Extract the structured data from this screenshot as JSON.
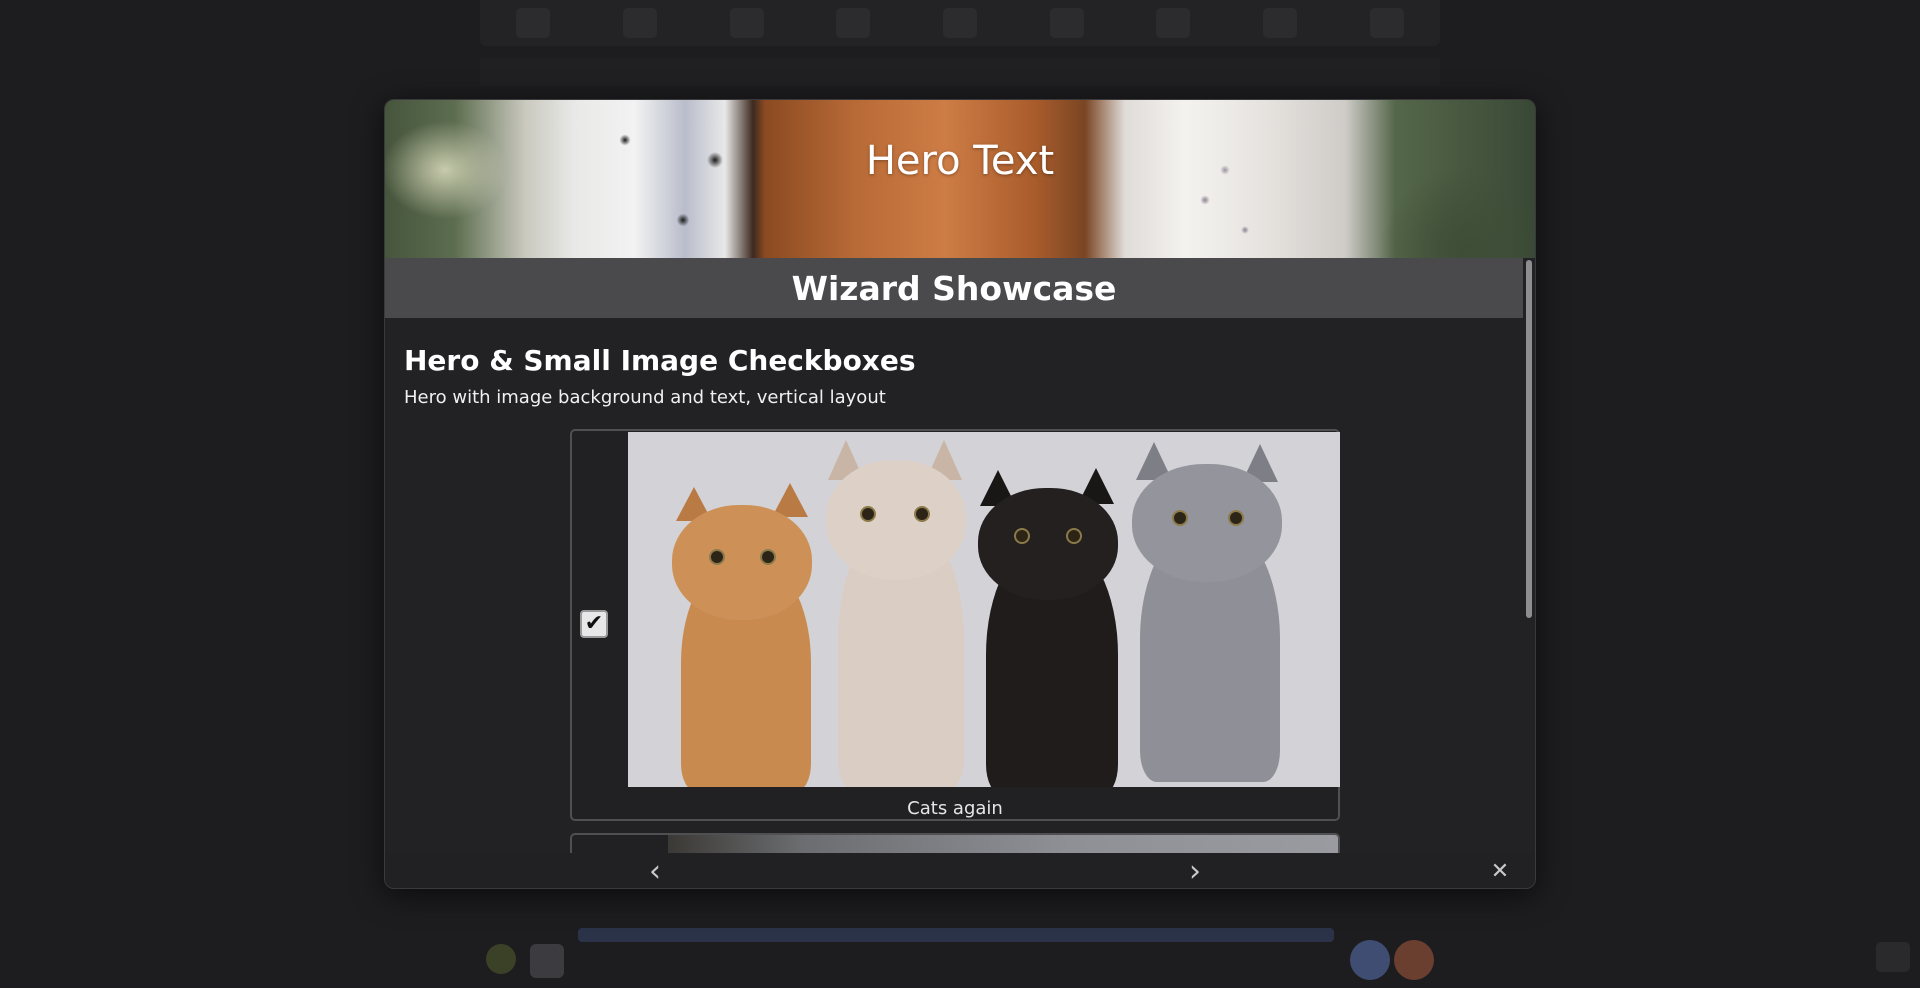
{
  "modal": {
    "hero": {
      "text": "Hero Text"
    },
    "title": "Wizard Showcase",
    "section": {
      "heading": "Hero & Small Image Checkboxes",
      "description": "Hero with image background and text, vertical layout"
    },
    "options": [
      {
        "caption": "Cats again",
        "checked": true,
        "image_icon": "cats-image"
      }
    ],
    "nav": {
      "prev_icon": "chevron-left-icon",
      "next_icon": "chevron-right-icon",
      "close_icon": "close-icon",
      "prev_glyph": "‹",
      "next_glyph": "›",
      "close_glyph": "✕"
    }
  },
  "checkbox_glyph": "✔",
  "colors": {
    "page_bg": "#1d1c1e",
    "modal_bg": "#222124",
    "title_bar_bg": "#4a494b",
    "text": "#ffffff"
  }
}
